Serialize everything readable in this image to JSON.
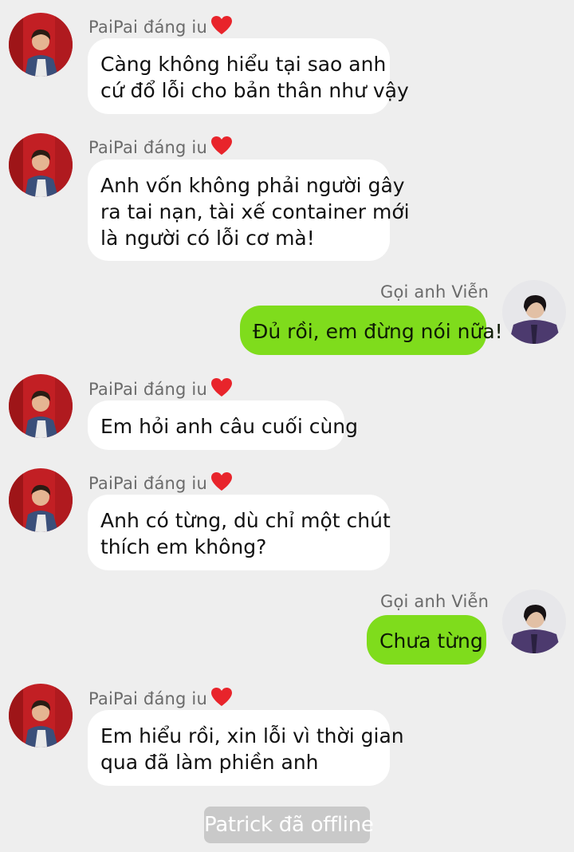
{
  "contacts": {
    "other_name": "PaiPai đáng iu",
    "self_name": "Gọi anh Viễn"
  },
  "messages": [
    {
      "side": "in",
      "lines": [
        "Càng không hiểu tại sao anh",
        "cứ đổ lỗi cho bản thân như vậy"
      ]
    },
    {
      "side": "in",
      "lines": [
        "Anh vốn không phải người gây",
        "ra tai nạn, tài xế container mới",
        "là người có lỗi cơ mà!"
      ]
    },
    {
      "side": "out",
      "lines": [
        "Đủ rồi, em đừng nói nữa!"
      ]
    },
    {
      "side": "in",
      "lines": [
        "Em hỏi anh câu cuối cùng"
      ]
    },
    {
      "side": "in",
      "lines": [
        "Anh có từng, dù chỉ một chút",
        "thích em không?"
      ]
    },
    {
      "side": "out",
      "lines": [
        "Chưa từng"
      ]
    },
    {
      "side": "in",
      "lines": [
        "Em hiểu rồi, xin lỗi vì thời gian",
        "qua đã làm phiền anh"
      ]
    }
  ],
  "system_note": "Patrick đã offline",
  "icons": {
    "heart": "heart-icon",
    "other_avatar": "avatar-paipai",
    "self_avatar": "avatar-vien"
  },
  "colors": {
    "background": "#eeeeee",
    "incoming_bubble": "#ffffff",
    "outgoing_bubble": "#7fdc1c",
    "heart": "#e8242b",
    "system_note_bg": "#c9c9c9"
  }
}
